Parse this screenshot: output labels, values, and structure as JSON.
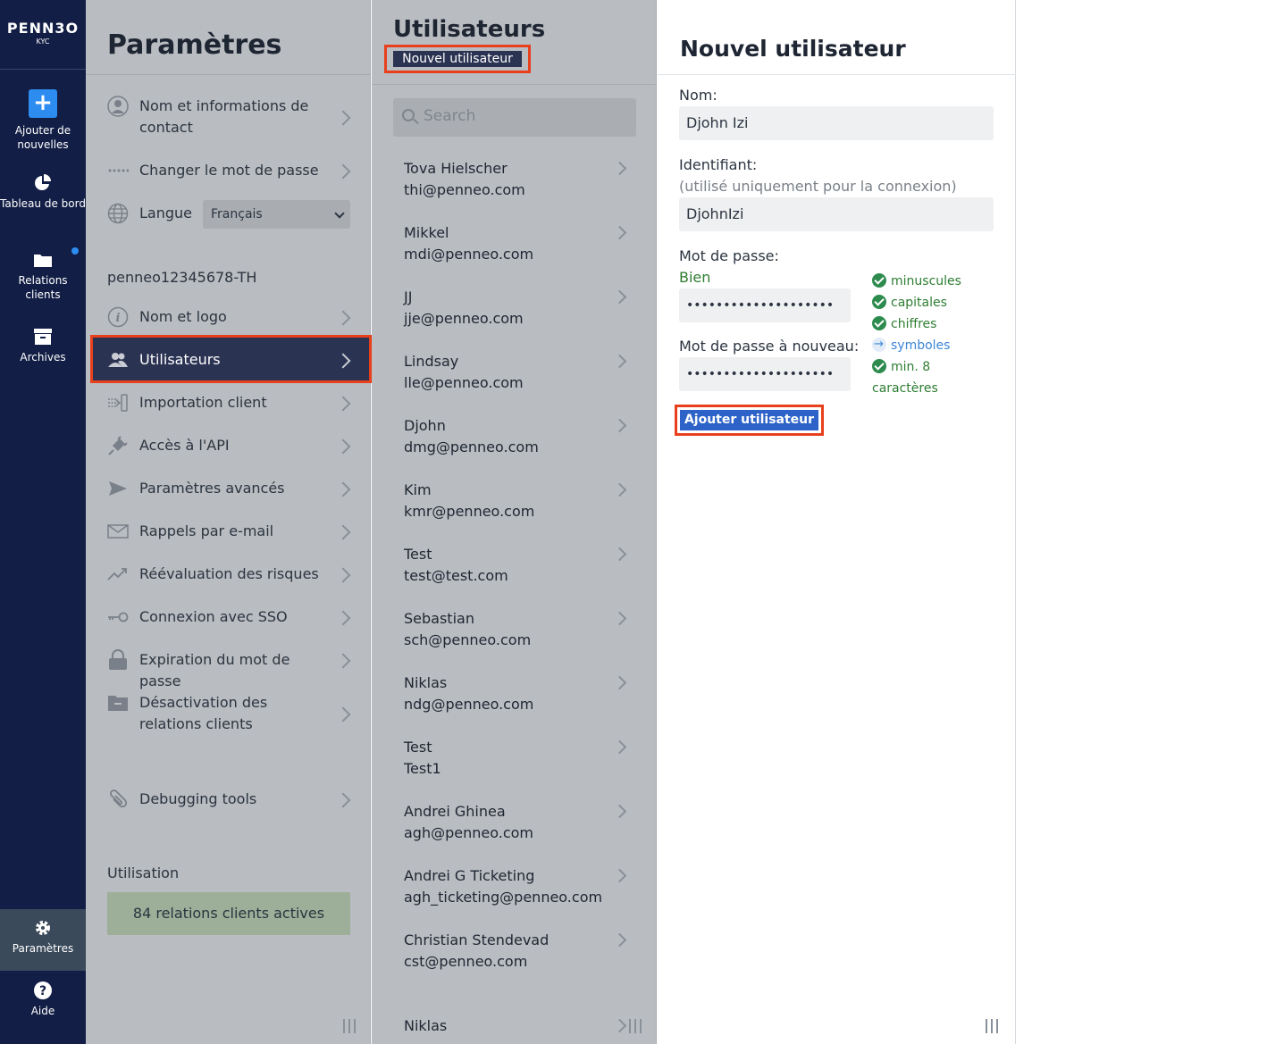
{
  "logo": {
    "main": "PENN3O",
    "sub": "KYC"
  },
  "rail": {
    "add_label": "Ajouter de nouvelles",
    "dashboard_label": "Tableau de bord",
    "clients_label": "Relations clients",
    "archives_label": "Archives",
    "settings_label": "Paramètres",
    "help_label": "Aide"
  },
  "settings": {
    "title": "Paramètres",
    "items": [
      {
        "label": "Nom et informations de contact"
      },
      {
        "label": "Changer le mot de passe"
      },
      {
        "label": "Langue"
      }
    ],
    "language_value": "Français",
    "account_id": "penneo12345678-TH",
    "org_items": [
      {
        "label": "Nom et logo"
      },
      {
        "label": "Utilisateurs"
      },
      {
        "label": "Importation client"
      },
      {
        "label": "Accès à l'API"
      },
      {
        "label": "Paramètres avancés"
      },
      {
        "label": "Rappels par e-mail"
      },
      {
        "label": "Réévaluation des risques"
      },
      {
        "label": "Connexion avec SSO"
      },
      {
        "label": "Expiration du mot de passe"
      },
      {
        "label": "Désactivation des relations clients"
      },
      {
        "label": "Debugging tools"
      }
    ],
    "usage_label": "Utilisation",
    "usage_value": "84 relations clients actives"
  },
  "users": {
    "title": "Utilisateurs",
    "new_button": "Nouvel utilisateur",
    "search_placeholder": "Search",
    "list": [
      {
        "name": "Tova Hielscher",
        "email": "thi@penneo.com"
      },
      {
        "name": "Mikkel",
        "email": "mdi@penneo.com"
      },
      {
        "name": "JJ",
        "email": "jje@penneo.com"
      },
      {
        "name": "Lindsay",
        "email": "lle@penneo.com"
      },
      {
        "name": "Djohn",
        "email": "dmg@penneo.com"
      },
      {
        "name": "Kim",
        "email": "kmr@penneo.com"
      },
      {
        "name": "Test",
        "email": "test@test.com"
      },
      {
        "name": "Sebastian",
        "email": "sch@penneo.com"
      },
      {
        "name": "Niklas",
        "email": "ndg@penneo.com"
      },
      {
        "name": "Test",
        "email": "Test1"
      },
      {
        "name": "Andrei Ghinea",
        "email": "agh@penneo.com"
      },
      {
        "name": "Andrei G Ticketing",
        "email": "agh_ticketing@penneo.com"
      },
      {
        "name": "Christian Stendevad",
        "email": "cst@penneo.com"
      },
      {
        "name": "Niklas",
        "email": ""
      }
    ]
  },
  "form": {
    "title": "Nouvel utilisateur",
    "name_label": "Nom:",
    "name_value": "Djohn Izi",
    "login_label": "Identifiant:",
    "login_hint": "(utilisé uniquement pour la connexion)",
    "login_value": "DjohnIzi",
    "password_label": "Mot de passe:",
    "strength": "Bien",
    "password_value": "••••••••••••••••••••",
    "password_repeat_label": "Mot de passe à nouveau:",
    "password_repeat_value": "••••••••••••••••••••",
    "rules": [
      {
        "label": "minuscules",
        "status": "ok"
      },
      {
        "label": "capitales",
        "status": "ok"
      },
      {
        "label": "chiffres",
        "status": "ok"
      },
      {
        "label": "symboles",
        "status": "pending"
      },
      {
        "label": "min. 8",
        "status": "ok"
      },
      {
        "label": "caractères",
        "status": "ok"
      }
    ],
    "submit": "Ajouter utilisateur"
  },
  "colors": {
    "rail": "#121e45",
    "accent": "#2d63c8",
    "highlight_outline": "#e8401c",
    "ok": "#2e7d32",
    "pending": "#3c86d6"
  }
}
